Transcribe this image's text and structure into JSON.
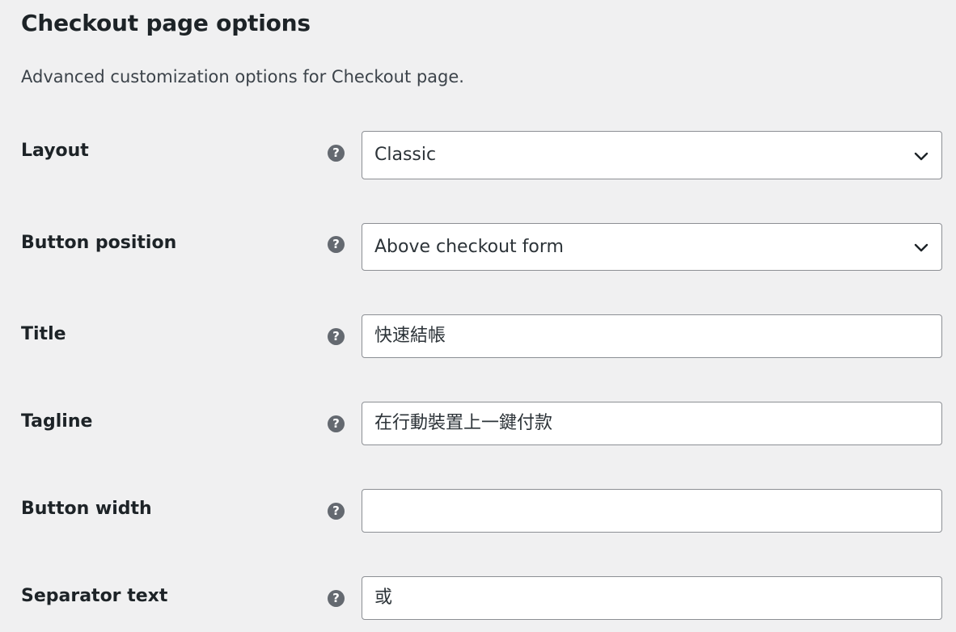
{
  "section": {
    "title": "Checkout page options",
    "description": "Advanced customization options for Checkout page."
  },
  "fields": {
    "layout": {
      "label": "Layout",
      "help_icon": "question-mark-icon",
      "value": "Classic",
      "type": "select"
    },
    "button_position": {
      "label": "Button position",
      "help_icon": "question-mark-icon",
      "value": "Above checkout form",
      "type": "select"
    },
    "title": {
      "label": "Title",
      "help_icon": "question-mark-icon",
      "value": "快速結帳",
      "type": "text"
    },
    "tagline": {
      "label": "Tagline",
      "help_icon": "question-mark-icon",
      "value": "在行動裝置上一鍵付款",
      "type": "text"
    },
    "button_width": {
      "label": "Button width",
      "help_icon": "question-mark-icon",
      "value": "",
      "type": "text"
    },
    "separator_text": {
      "label": "Separator text",
      "help_icon": "question-mark-icon",
      "value": "或",
      "type": "text"
    }
  },
  "help_glyph": "?",
  "colors": {
    "background": "#f0f0f1",
    "input_border": "#8c8f94",
    "help_icon": "#646970",
    "text": "#1d2327"
  }
}
